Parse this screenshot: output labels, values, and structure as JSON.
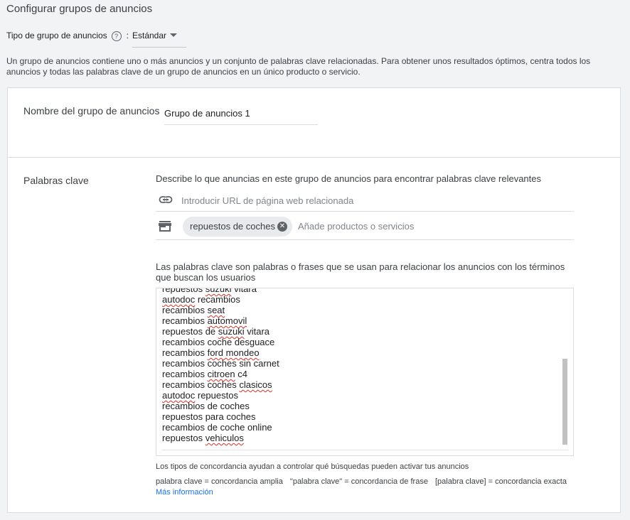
{
  "page": {
    "title": "Configurar grupos de anuncios",
    "ad_group_type_label": "Tipo de grupo de anuncios",
    "help_glyph": "?",
    "colon": ":",
    "ad_group_type_value": "Estándar",
    "intro": "Un grupo de anuncios contiene uno o más anuncios y un conjunto de palabras clave relacionadas. Para obtener unos resultados óptimos, centra todos los anuncios y todas las palabras clave de un grupo de anuncios en un único producto o servicio."
  },
  "ad_group_name": {
    "label": "Nombre del grupo de anuncios",
    "value": "Grupo de anuncios 1"
  },
  "keywords": {
    "label": "Palabras clave",
    "description": "Describe lo que anuncias en este grupo de anuncios para encontrar palabras clave relevantes",
    "url_placeholder": "Introducir URL de página web relacionada",
    "product_chip": "repuestos de coches",
    "chip_close_glyph": "✕",
    "product_placeholder": "Añade productos o servicios",
    "explanation": "Las palabras clave son palabras o frases que se usan para relacionar los anuncios con los términos que buscan los usuarios",
    "list": [
      "repuestos suzuki vitara",
      "autodoc recambios",
      "recambios seat",
      "recambios automovil",
      "repuestos de suzuki vitara",
      "recambios coche desguace",
      "recambios ford mondeo",
      "recambios coches sin carnet",
      "recambios citroen c4",
      "recambios coches clasicos",
      "autodoc repuestos",
      "recambios de coches",
      "repuestos para coches",
      "recambios de coche online",
      "repuestos vehiculos"
    ],
    "match_note": "Los tipos de concordancia ayudan a controlar qué búsquedas pueden activar tus anuncios",
    "match_broad": "palabra clave = concordancia amplia",
    "match_phrase": "\"palabra clave\" = concordancia de frase",
    "match_exact": "[palabra clave] = concordancia exacta",
    "more_info": "Más información"
  },
  "colors": {
    "accent": "#1a73e8",
    "spellcheck": "#d93025"
  }
}
